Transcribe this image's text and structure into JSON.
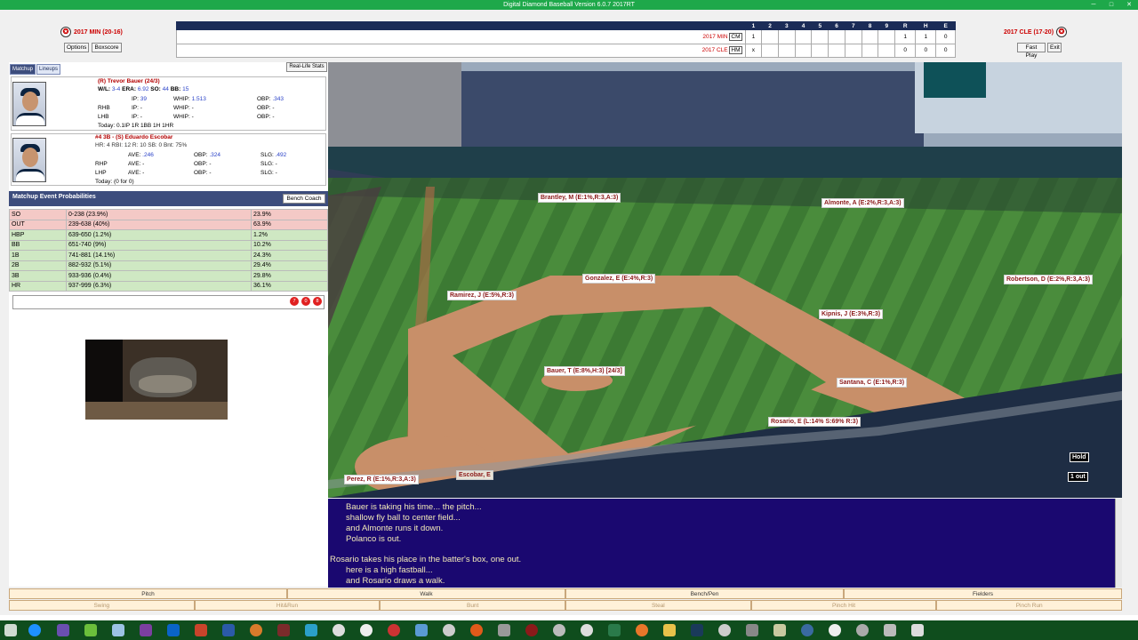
{
  "window": {
    "title": "Digital Diamond Baseball Version 6.0.7 2017RT"
  },
  "away": {
    "label": "2017 MIN (20-16)",
    "short": "2017 MIN",
    "code": "CM",
    "innings": [
      "1",
      "",
      "",
      "",
      "",
      "",
      "",
      "",
      ""
    ],
    "r": "1",
    "h": "1",
    "e": "0"
  },
  "home": {
    "label": "2017 CLE (17-20)",
    "short": "2017 CLE",
    "code": "HM",
    "innings": [
      "x",
      "",
      "",
      "",
      "",
      "",
      "",
      "",
      ""
    ],
    "r": "0",
    "h": "0",
    "e": "0"
  },
  "linescore": {
    "headers": [
      "1",
      "2",
      "3",
      "4",
      "5",
      "6",
      "7",
      "8",
      "9",
      "R",
      "H",
      "E"
    ]
  },
  "buttons": {
    "options": "Options",
    "boxscore": "Boxscore",
    "fastplay": "Fast Play",
    "exit": "Exit",
    "reallife": "Real-Life Stats",
    "benchcoach": "Bench Coach"
  },
  "tabs": {
    "matchup": "Matchup",
    "lineups": "Lineups"
  },
  "pitcher": {
    "name": "(R) Trevor Bauer (24/3)",
    "line1_label": "W/L:",
    "wl": "3-4",
    "era_label": "ERA:",
    "era": "6.92",
    "so_label": "SO:",
    "so": "44",
    "bb_label": "BB:",
    "bb": "15",
    "ip_label": "IP:",
    "ip": "39",
    "whip_label": "WHIP:",
    "whip": "1.513",
    "obp_label": "OBP:",
    "obp": ".343",
    "rhb": "RHB",
    "lhb": "LHB",
    "ip_r": "IP: -",
    "whip_r": "WHIP: -",
    "obp_r": "OBP: -",
    "ip_l": "IP: -",
    "whip_l": "WHIP: -",
    "obp_l": "OBP: -",
    "today": "Today: 0.1IP 1R 1BB 1H 1HR"
  },
  "batter": {
    "name": "#4 3B - (S) Eduardo Escobar",
    "line": "HR: 4 RBI: 12 R: 10 SB: 0 Bnt: 75%",
    "ave_label": "AVE:",
    "ave": ".246",
    "obp_label": "OBP:",
    "obp": ".324",
    "slg_label": "SLG:",
    "slg": ".492",
    "rhp": "RHP",
    "lhp": "LHP",
    "ave_r": "AVE: -",
    "obp_r": "OBP: -",
    "slg_r": "SLG: -",
    "ave_l": "AVE: -",
    "obp_l": "OBP: -",
    "slg_l": "SLG: -",
    "today": "Today: (0 for 0)"
  },
  "probabilities": {
    "title": "Matchup Event Probabilities",
    "rows": [
      {
        "event": "SO",
        "range": "0-238 (23.9%)",
        "pct": "23.9%"
      },
      {
        "event": "OUT",
        "range": "239-638 (40%)",
        "pct": "63.9%"
      },
      {
        "event": "HBP",
        "range": "639-650 (1.2%)",
        "pct": "1.2%"
      },
      {
        "event": "BB",
        "range": "651-740 (9%)",
        "pct": "10.2%"
      },
      {
        "event": "1B",
        "range": "741-881 (14.1%)",
        "pct": "24.3%"
      },
      {
        "event": "2B",
        "range": "882-932 (5.1%)",
        "pct": "29.4%"
      },
      {
        "event": "3B",
        "range": "933-936 (0.4%)",
        "pct": "29.8%"
      },
      {
        "event": "HR",
        "range": "937-999 (6.3%)",
        "pct": "36.1%"
      }
    ]
  },
  "dice": [
    "7",
    "0",
    "8"
  ],
  "fielders": {
    "brantley": "Brantley, M (E:1%,R:3,A:3)",
    "almonte": "Almonte, A (E:2%,R:3,A:3)",
    "gonzalez": "Gonzalez, E (E:4%,R:3)",
    "robertson": "Robertson, D (E:2%,R:3,A:3)",
    "ramirez": "Ramirez, J (E:5%,R:3)",
    "kipnis": "Kipnis, J (E:3%,R:3)",
    "bauer": "Bauer, T (E:8%,H:3) [24/3]",
    "santana": "Santana, C (E:1%,R:3)",
    "rosario": "Rosario, E (L:14% S:69% R:3)",
    "escobar": "Escobar, E",
    "perez": "Perez, R (E:1%,R:3,A:3)",
    "hold": "Hold",
    "outs": "1 out"
  },
  "pbp": {
    "lines": [
      "Bauer is taking his time... the pitch...",
      "shallow fly ball to center field...",
      "and Almonte runs it down.",
      "Polanco is out.",
      "Rosario takes his place in the batter's box, one out.",
      "here is a high fastball...",
      "and Rosario draws a walk."
    ]
  },
  "actions": {
    "pitch": "Pitch",
    "walk": "Walk",
    "benchpen": "Bench/Pen",
    "fielders": "Fielders",
    "swing": "Swing",
    "hitrun": "Hit&Run",
    "bunt": "Bunt",
    "steal": "Steal",
    "pinchhit": "Pinch Hit",
    "pinchrun": "Pinch Run"
  },
  "colors": {
    "titlebar": "#1ea84a",
    "navy": "#1b2c57",
    "pbp_bg": "#1a0870",
    "pbp_text": "#f2e9b8"
  }
}
